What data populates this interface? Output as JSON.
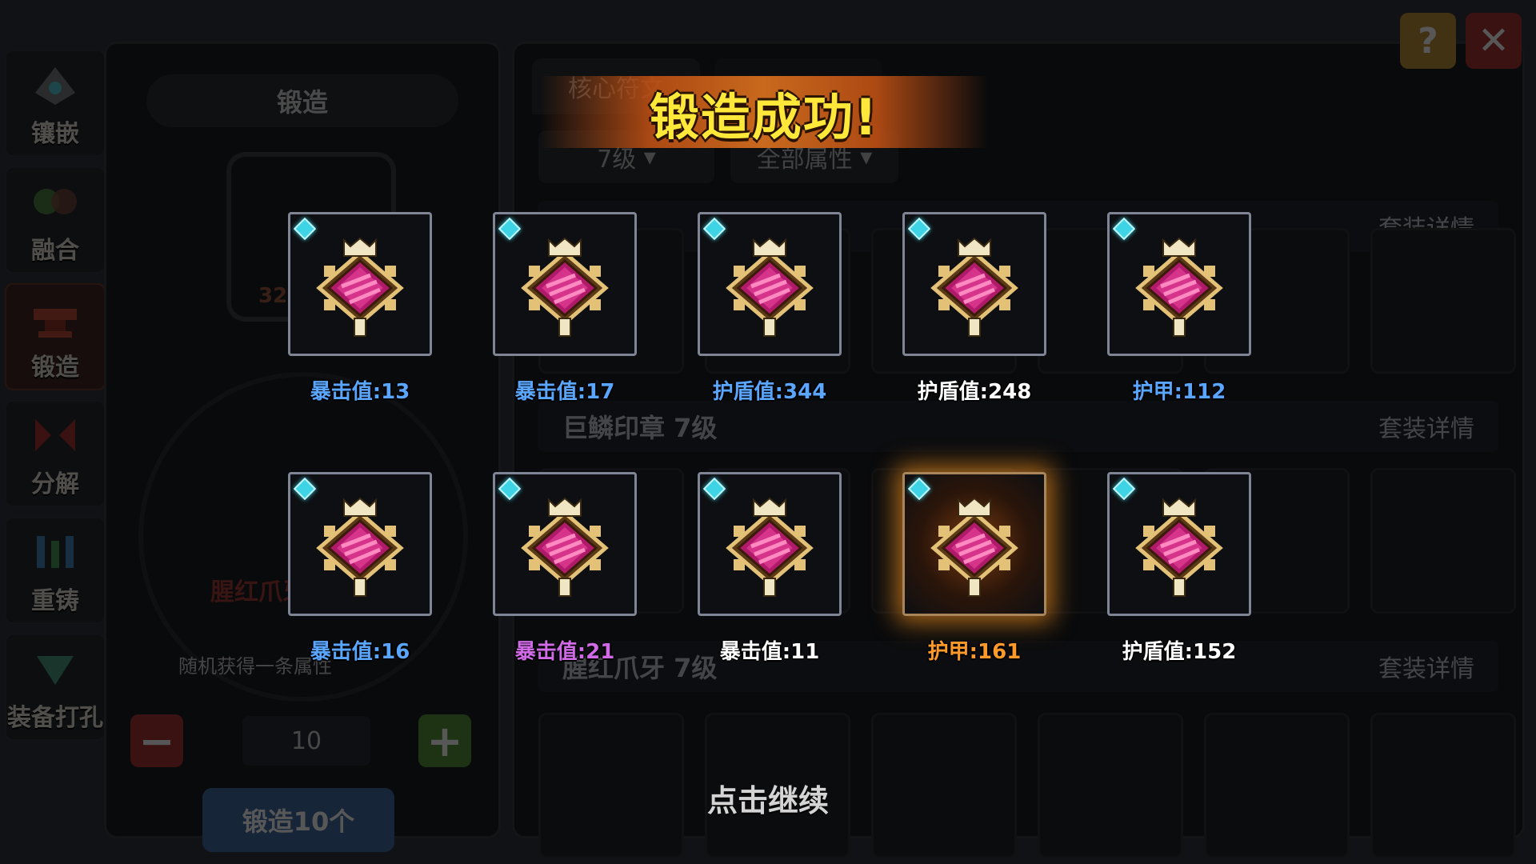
{
  "sidebar": {
    "items": [
      {
        "label": "镶嵌",
        "icon": "socket-icon"
      },
      {
        "label": "融合",
        "icon": "fusion-icon"
      },
      {
        "label": "锻造",
        "icon": "anvil-icon"
      },
      {
        "label": "分解",
        "icon": "decompose-icon"
      },
      {
        "label": "重铸",
        "icon": "recast-icon"
      },
      {
        "label": "装备打孔",
        "icon": "drill-icon"
      }
    ]
  },
  "left_panel": {
    "title": "锻造",
    "count": "324/10",
    "item_name": "腥红爪牙",
    "hint": "随机获得一条属性",
    "quantity": "10",
    "forge_button": "锻造10个"
  },
  "right_panel": {
    "tabs": [
      "核心符文",
      ""
    ],
    "level_filter": "7级",
    "attribute_filter": "全部属性",
    "sets": [
      {
        "name": "",
        "details": "套装详情"
      },
      {
        "name": "巨鳞印章 7级",
        "details": "套装详情"
      },
      {
        "name": "腥红爪牙 7级",
        "details": "套装详情"
      }
    ]
  },
  "dialog": {
    "title": "锻造成功!",
    "results": [
      {
        "stat": "暴击值:13",
        "color": "#5aa6ff"
      },
      {
        "stat": "暴击值:17",
        "color": "#5aa6ff"
      },
      {
        "stat": "护盾值:344",
        "color": "#5aa6ff"
      },
      {
        "stat": "护盾值:248",
        "color": "#ffffff"
      },
      {
        "stat": "护甲:112",
        "color": "#5aa6ff"
      },
      {
        "stat": "暴击值:16",
        "color": "#5aa6ff"
      },
      {
        "stat": "暴击值:21",
        "color": "#d06ae6"
      },
      {
        "stat": "暴击值:11",
        "color": "#ffffff"
      },
      {
        "stat": "护甲:161",
        "color": "#ff9a2a"
      },
      {
        "stat": "护盾值:152",
        "color": "#ffffff"
      }
    ],
    "continue_text": "点击继续"
  },
  "colors": {
    "title_yellow": "#ffe83a",
    "rare_blue": "#5aa6ff",
    "epic_purple": "#d06ae6",
    "legend_orange": "#ff9a2a",
    "common_white": "#ffffff"
  }
}
